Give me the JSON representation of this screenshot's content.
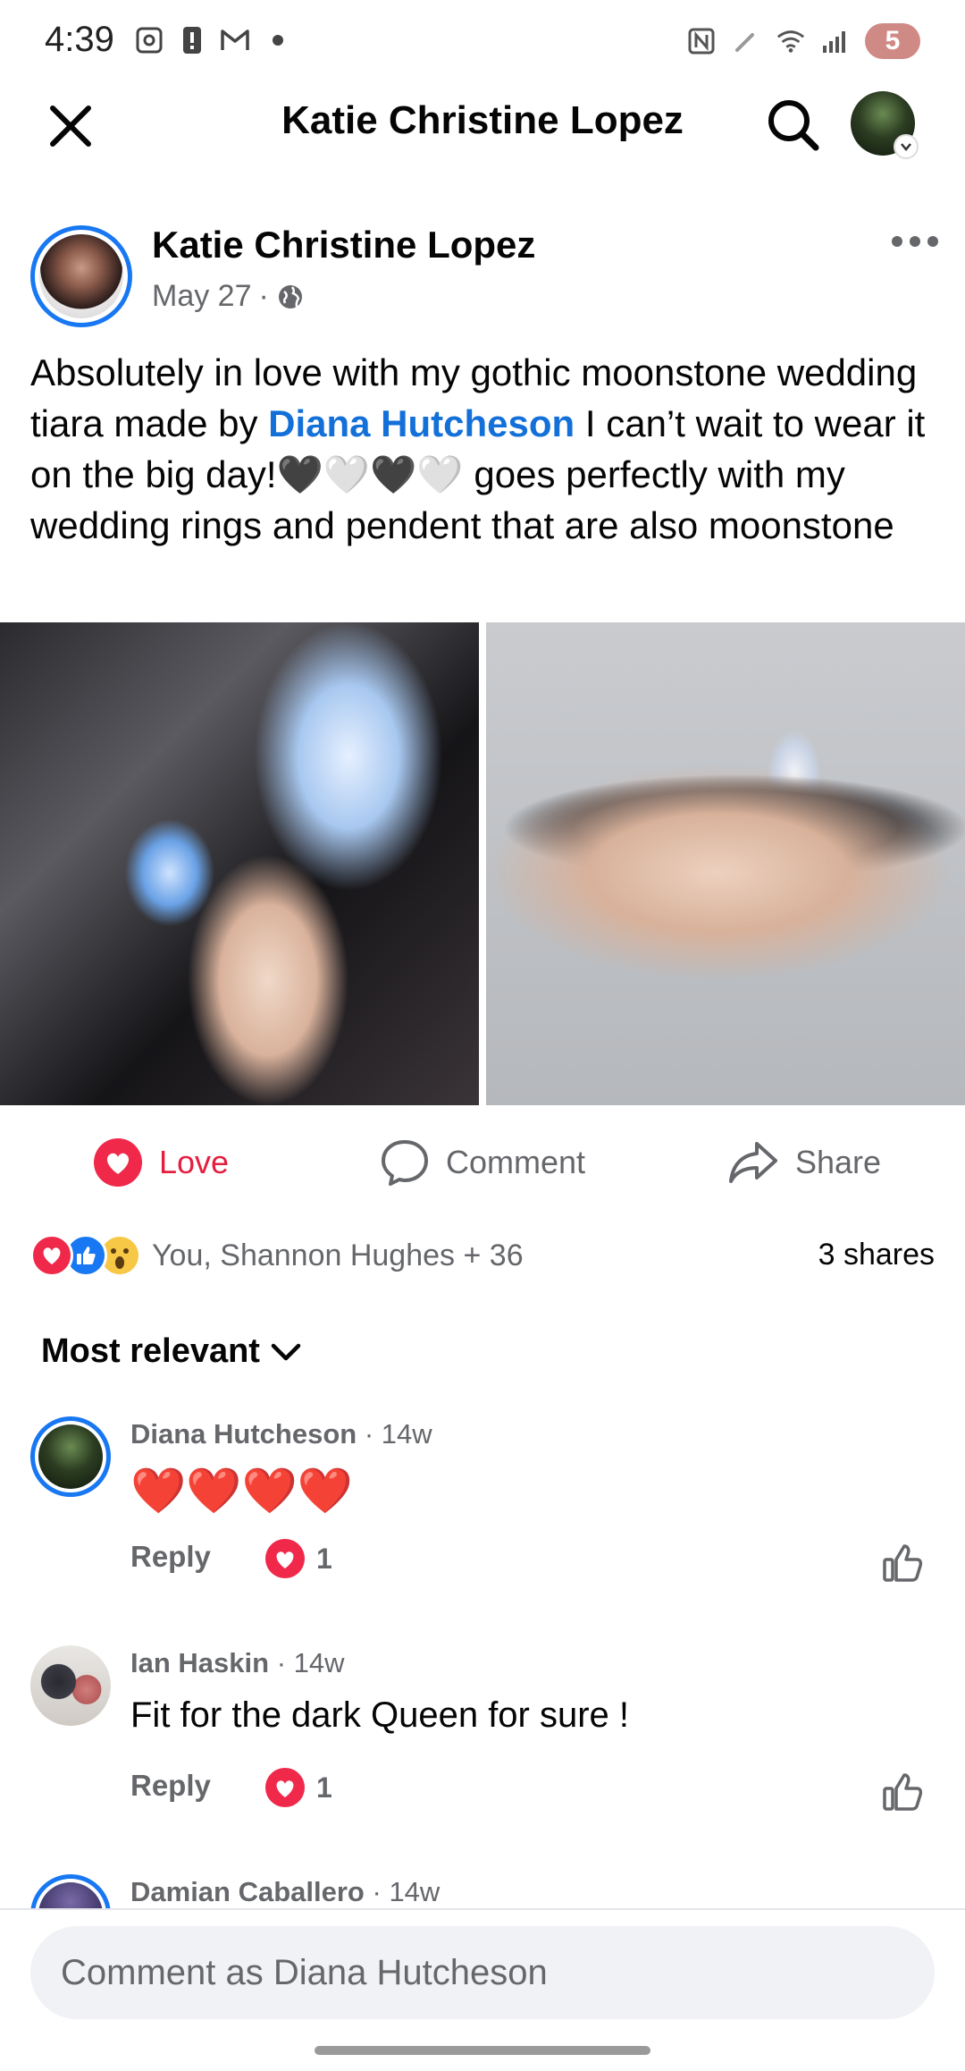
{
  "status_bar": {
    "time": "4:39",
    "battery": "5"
  },
  "header": {
    "title": "Katie Christine Lopez"
  },
  "post": {
    "author": "Katie Christine Lopez",
    "date": "May 27",
    "text_part1": "Absolutely in love with my gothic moonstone wedding tiara made by ",
    "mention": "Diana Hutcheson",
    "text_part2": " I can’t wait to wear it on the big day!🖤🤍🖤🤍 goes perfectly with my wedding rings and pendent that are also moonstone"
  },
  "actions": {
    "love": "Love",
    "comment": "Comment",
    "share": "Share"
  },
  "reactions": {
    "summary": "You, Shannon Hughes + 36",
    "shares": "3 shares"
  },
  "sort": {
    "label": "Most relevant"
  },
  "comments": [
    {
      "name": "Diana Hutcheson",
      "time": "14w",
      "body": "❤️❤️❤️❤️",
      "reply": "Reply",
      "reaction_count": "1"
    },
    {
      "name": "Ian Haskin",
      "time": "14w",
      "body": "Fit for the dark Queen for sure !",
      "reply": "Reply",
      "reaction_count": "1"
    },
    {
      "name": "Damian Caballero",
      "time": "14w"
    }
  ],
  "composer": {
    "placeholder": "Comment as Diana Hutcheson"
  },
  "colors": {
    "love": "#e41e3f",
    "mention": "#1470d9",
    "ring": "#1877f2"
  }
}
